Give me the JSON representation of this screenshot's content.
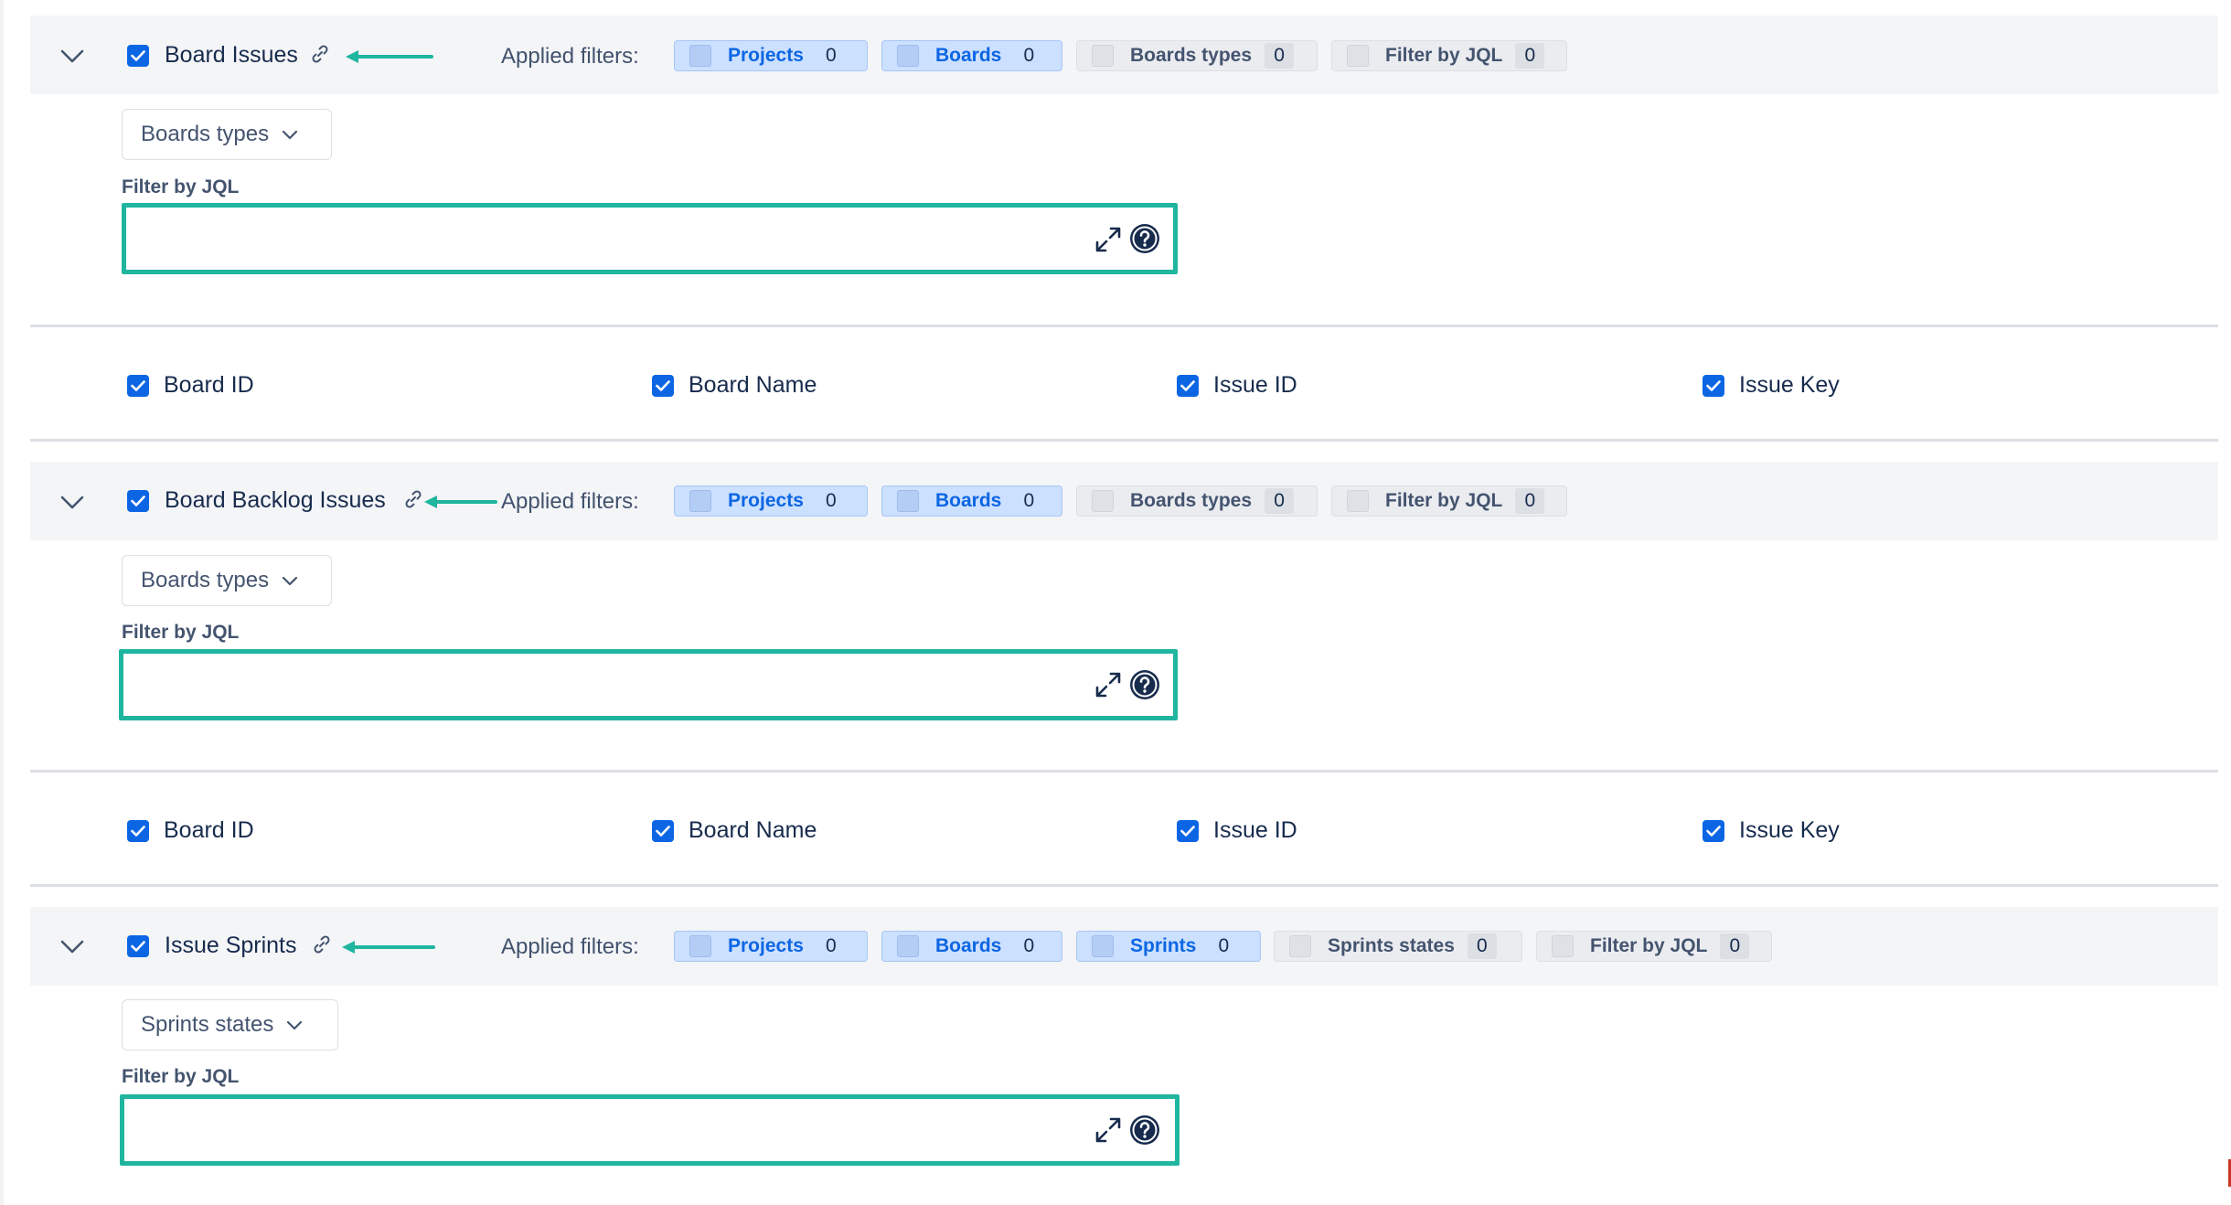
{
  "sections": [
    {
      "title": "Board Issues",
      "applied_label": "Applied filters:",
      "chips": [
        {
          "label": "Projects",
          "count": "0",
          "active": true
        },
        {
          "label": "Boards",
          "count": "0",
          "active": true
        },
        {
          "label": "Boards types",
          "count": "0",
          "active": false
        },
        {
          "label": "Filter by JQL",
          "count": "0",
          "active": false
        }
      ],
      "dropdown": "Boards types",
      "jql_label": "Filter by JQL",
      "jql_value": "",
      "fields": [
        "Board ID",
        "Board Name",
        "Issue ID",
        "Issue Key"
      ]
    },
    {
      "title": "Board Backlog Issues",
      "applied_label": "Applied filters:",
      "chips": [
        {
          "label": "Projects",
          "count": "0",
          "active": true
        },
        {
          "label": "Boards",
          "count": "0",
          "active": true
        },
        {
          "label": "Boards types",
          "count": "0",
          "active": false
        },
        {
          "label": "Filter by JQL",
          "count": "0",
          "active": false
        }
      ],
      "dropdown": "Boards types",
      "jql_label": "Filter by JQL",
      "jql_value": "",
      "fields": [
        "Board ID",
        "Board Name",
        "Issue ID",
        "Issue Key"
      ]
    },
    {
      "title": "Issue Sprints",
      "applied_label": "Applied filters:",
      "chips": [
        {
          "label": "Projects",
          "count": "0",
          "active": true
        },
        {
          "label": "Boards",
          "count": "0",
          "active": true
        },
        {
          "label": "Sprints",
          "count": "0",
          "active": true
        },
        {
          "label": "Sprints states",
          "count": "0",
          "active": false
        },
        {
          "label": "Filter by JQL",
          "count": "0",
          "active": false
        }
      ],
      "dropdown": "Sprints states",
      "jql_label": "Filter by JQL",
      "jql_value": ""
    }
  ],
  "colors": {
    "accent": "#0c66e4",
    "highlight": "#1fb59f",
    "header_bg": "#f4f5f7"
  },
  "icons": {
    "collapse": "chevron-down-icon",
    "checkbox": "check-icon",
    "link": "link-icon",
    "annotation": "arrow-left-icon",
    "dropdown": "chevron-down-icon",
    "expand": "expand-icon",
    "help": "help-icon"
  }
}
